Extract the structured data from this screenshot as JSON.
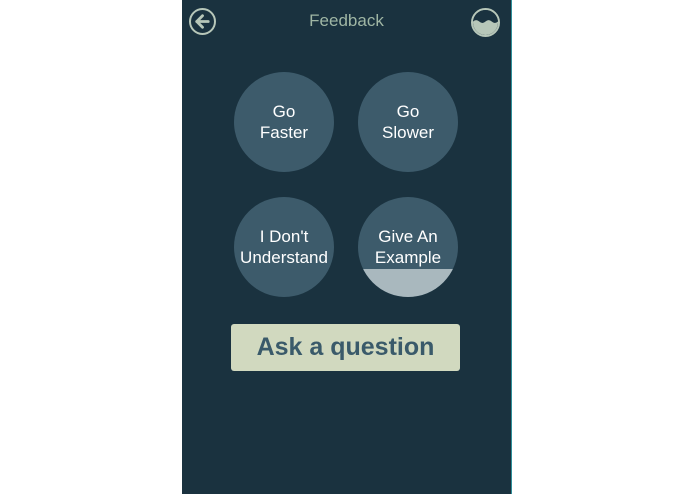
{
  "header": {
    "title": "Feedback",
    "back_icon": "back-arrow-icon",
    "status_icon": "water-level-icon"
  },
  "feedback_options": [
    {
      "label": "Go\nFaster",
      "level": 0
    },
    {
      "label": "Go\nSlower",
      "level": 0
    },
    {
      "label": "I Don't\nUnderstand",
      "level": 0
    },
    {
      "label": "Give An\nExample",
      "level": 0.28
    }
  ],
  "ask_button": {
    "label": "Ask a question"
  },
  "colors": {
    "background": "#1a323f",
    "circle": "#3d5b6b",
    "circle_fill": "#a9b8be",
    "title_text": "#9fb6a4",
    "ask_button_bg": "#d1d9bf",
    "ask_button_text": "#3a5a6a"
  }
}
